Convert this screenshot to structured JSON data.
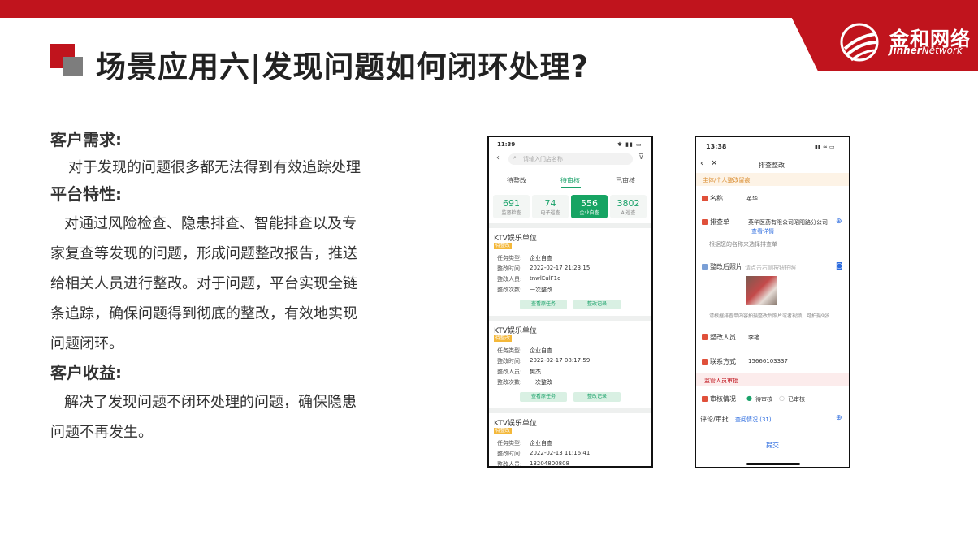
{
  "brand": {
    "name_cn": "金和网络",
    "name_en_bold": "Jinher",
    "name_en_light": "Network"
  },
  "title": "场景应用六|发现问题如何闭环处理?",
  "sections": [
    {
      "heading": "客户需求:",
      "text": "对于发现的问题很多都无法得到有效追踪处理"
    },
    {
      "heading": "平台特性:",
      "lines": [
        "对通过风险检查、隐患排查、智能排查以及专",
        "家复查等发现的问题，形成问题整改报告，推送",
        "给相关人员进行整改。对于问题，平台实现全链",
        "条追踪，确保问题得到彻底的整改，有效地实现",
        "问题闭环。"
      ]
    },
    {
      "heading": "客户收益:",
      "lines": [
        "解决了发现问题不闭环处理的问题，确保隐患",
        "问题不再发生。"
      ]
    }
  ],
  "phone1": {
    "time": "11:39",
    "search_placeholder": "请输入门店名称",
    "tabs": [
      "待整改",
      "待审核",
      "已审核"
    ],
    "stats": [
      {
        "value": "691",
        "label": "监督检查"
      },
      {
        "value": "74",
        "label": "电子巡查"
      },
      {
        "value": "556",
        "label": "企业自查"
      },
      {
        "value": "3802",
        "label": "AI巡查"
      }
    ],
    "cards": [
      {
        "name": "KTV娱乐单位",
        "tag": "待整改",
        "type_label": "任务类型:",
        "type": "企业自查",
        "time_label": "整改时间:",
        "time": "2022-02-17 21:23:15",
        "person_label": "整改人员:",
        "person": "tnwlEulF1q",
        "count_label": "整改次数:",
        "count": "一次整改",
        "btn1": "查看原任务",
        "btn2": "整改记录"
      },
      {
        "name": "KTV娱乐单位",
        "tag": "待整改",
        "type_label": "任务类型:",
        "type": "企业自查",
        "time_label": "整改时间:",
        "time": "2022-02-17 08:17:59",
        "person_label": "整改人员:",
        "person": "樊杰",
        "count_label": "整改次数:",
        "count": "一次整改",
        "btn1": "查看原任务",
        "btn2": "整改记录"
      },
      {
        "name": "KTV娱乐单位",
        "tag": "待整改",
        "type_label": "任务类型:",
        "type": "企业自查",
        "time_label": "整改时间:",
        "time": "2022-02-13 11:16:41",
        "person_label": "整改人员:",
        "person": "13204800808"
      }
    ]
  },
  "phone2": {
    "time": "13:38",
    "header": "排查整改",
    "subtitle": "主体/个人整改留痕",
    "name_label": "名称",
    "name_value": "英华",
    "sheet_label": "排查单",
    "sheet_value": "英华医药有限公司昭阳路分公司",
    "sheet_link": "查看详情",
    "sheet_hint": "根据您的名称来选择排查单",
    "photo_label": "整改后照片",
    "photo_placeholder": "请点击右侧按钮拍照",
    "photo_hint": "请根据排查单内容拍摄整改后照片或者视频，可拍摄9张",
    "person_label": "整改人员",
    "person_value": "李艳",
    "contact_label": "联系方式",
    "contact_value": "15666103337",
    "supervisor": "监管人员审批",
    "review_label": "审核情况",
    "review_opt1": "待审核",
    "review_opt2": "已审核",
    "comment_label": "评论/审批",
    "comment_link": "查阅情况 (31)",
    "submit": "提交"
  }
}
